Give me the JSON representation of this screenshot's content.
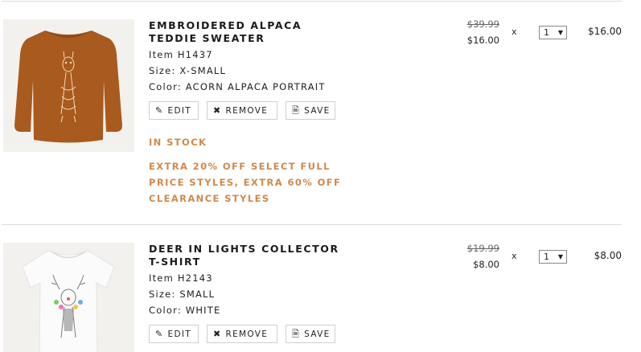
{
  "cart": {
    "items": [
      {
        "name": "EMBROIDERED ALPACA TEDDIE SWEATER",
        "item_no": "Item H1437",
        "size": "Size: X-SMALL",
        "color": "Color: ACORN ALPACA PORTRAIT",
        "stock": "IN STOCK",
        "promo": "EXTRA 20% OFF SELECT FULL PRICE STYLES, EXTRA 60% OFF CLEARANCE STYLES",
        "original_price": "$39.99",
        "sale_price": "$16.00",
        "times": "x",
        "quantity": "1",
        "total": "$16.00",
        "image": "sweater-alpaca-image"
      },
      {
        "name": "DEER IN LIGHTS COLLECTOR T-SHIRT",
        "item_no": "Item H2143",
        "size": "Size: SMALL",
        "color": "Color: WHITE",
        "original_price": "$19.99",
        "sale_price": "$8.00",
        "times": "x",
        "quantity": "1",
        "total": "$8.00",
        "image": "tshirt-deer-image"
      }
    ],
    "buttons": {
      "edit": "EDIT",
      "remove": "REMOVE",
      "save": "SAVE"
    },
    "icons": {
      "edit": "pencil-icon",
      "remove": "x-icon",
      "save": "document-icon",
      "qty": "caret-down-icon"
    },
    "colors": {
      "accent": "#d2894a",
      "sweater": "#a85a1f"
    }
  }
}
